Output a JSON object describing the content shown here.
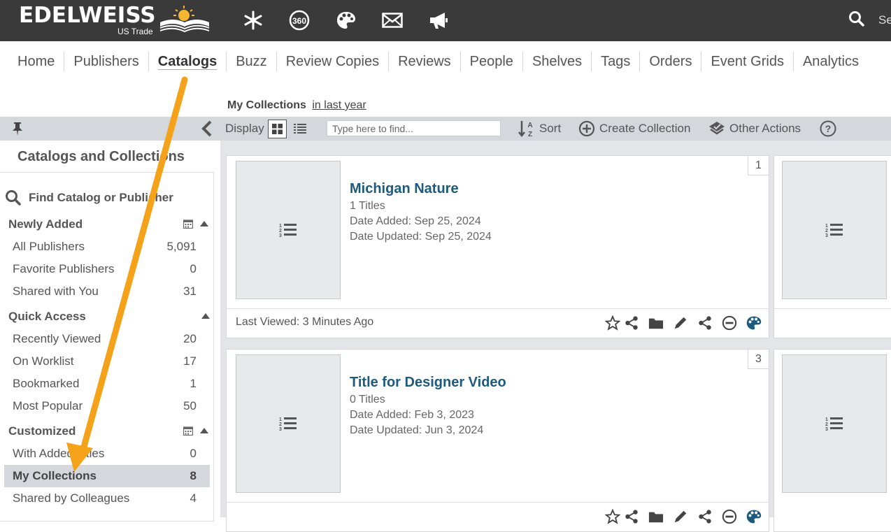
{
  "brand": {
    "name": "EDELWEISS",
    "sub": "US Trade"
  },
  "top_icons": [
    "snowflake-icon",
    "360-icon",
    "palette-icon",
    "mail-icon",
    "megaphone-icon"
  ],
  "top_icon_360_label": "360",
  "search_partial": "Se",
  "nav": {
    "items": [
      "Home",
      "Publishers",
      "Catalogs",
      "Buzz",
      "Review Copies",
      "Reviews",
      "People",
      "Shelves",
      "Tags",
      "Orders",
      "Event Grids",
      "Analytics"
    ],
    "active": "Catalogs"
  },
  "collection_header": {
    "title": "My Collections",
    "filter": "in last year"
  },
  "toolbar": {
    "display_label": "Display",
    "find_placeholder": "Type here to find...",
    "sort_label": "Sort",
    "create_label": "Create Collection",
    "other_label": "Other Actions"
  },
  "sidebar": {
    "title": "Catalogs and Collections",
    "find_label": "Find Catalog or Publisher",
    "sections": [
      {
        "heading": "Newly Added",
        "rows": [
          {
            "label": "All Publishers",
            "count": "5,091"
          },
          {
            "label": "Favorite Publishers",
            "count": "0"
          },
          {
            "label": "Shared with You",
            "count": "31"
          }
        ]
      },
      {
        "heading": "Quick Access",
        "rows": [
          {
            "label": "Recently Viewed",
            "count": "20"
          },
          {
            "label": "On Worklist",
            "count": "17"
          },
          {
            "label": "Bookmarked",
            "count": "1"
          },
          {
            "label": "Most Popular",
            "count": "50"
          }
        ]
      },
      {
        "heading": "Customized",
        "rows": [
          {
            "label": "With Added Titles",
            "count": "0"
          },
          {
            "label": "My Collections",
            "count": "8"
          },
          {
            "label": "Shared by Colleagues",
            "count": "4"
          }
        ]
      }
    ],
    "selected": "My Collections"
  },
  "cards": [
    {
      "number": "1",
      "title": "Michigan Nature",
      "titles": "1 Titles",
      "added": "Date Added: Sep 25, 2024",
      "updated": "Date Updated: Sep 25, 2024",
      "last_viewed": "Last Viewed: 3 Minutes Ago"
    },
    {
      "number": "3",
      "title": "Title for Designer Video",
      "titles": "0 Titles",
      "added": "Date Added: Feb 3, 2023",
      "updated": "Date Updated: Jun 3, 2024",
      "last_viewed": ""
    }
  ],
  "colors": {
    "topbar": "#3a3a3a",
    "toolbar": "#d4d7db",
    "title_link": "#1c5a7e",
    "arrow": "#f5a21b"
  }
}
